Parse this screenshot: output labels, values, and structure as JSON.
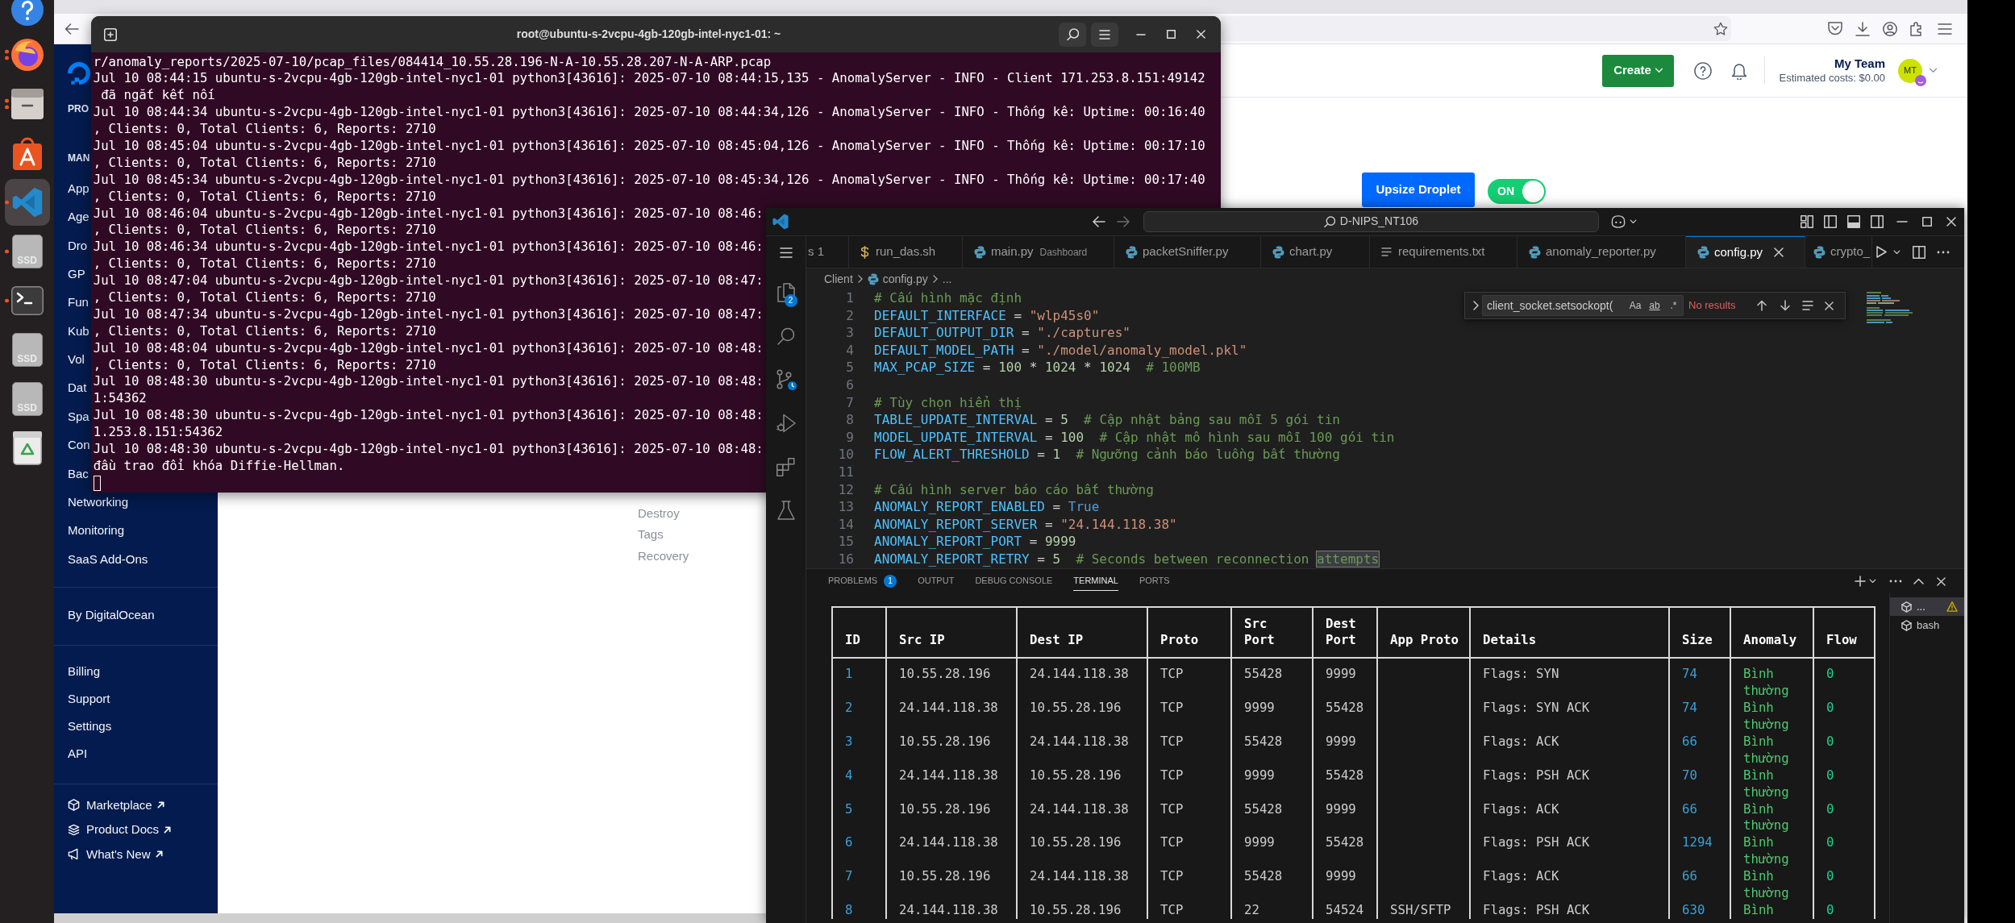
{
  "dock": [
    {
      "kind": "help",
      "running": false,
      "multiple": false,
      "selected": false
    },
    {
      "kind": "browser",
      "running": true,
      "multiple": true,
      "selected": false
    },
    {
      "kind": "files",
      "running": true,
      "multiple": true,
      "selected": false
    },
    {
      "kind": "store",
      "running": false,
      "multiple": false,
      "selected": false
    },
    {
      "kind": "editor",
      "running": true,
      "multiple": false,
      "selected": true
    },
    {
      "kind": "drive",
      "label": "SSD",
      "running": true,
      "multiple": false,
      "selected": false
    },
    {
      "kind": "terminal",
      "running": true,
      "multiple": false,
      "selected": false
    },
    {
      "kind": "drive",
      "label": "SSD",
      "running": false,
      "multiple": false,
      "selected": false
    },
    {
      "kind": "drive",
      "label": "SSD",
      "running": false,
      "multiple": false,
      "selected": false
    },
    {
      "kind": "trash",
      "running": false,
      "multiple": false,
      "selected": false
    }
  ],
  "digitalocean": {
    "sidebar": [
      {
        "items": [
          {
            "kind": "heading",
            "label": "PRO"
          },
          {
            "kind": "heading",
            "label": "MAN"
          },
          {
            "kind": "link",
            "label": "App"
          },
          {
            "kind": "link",
            "label": "Age"
          },
          {
            "kind": "link",
            "label": "Dro"
          },
          {
            "kind": "link",
            "label": "GP"
          },
          {
            "kind": "link",
            "label": "Fun"
          },
          {
            "kind": "link",
            "label": "Kub"
          },
          {
            "kind": "link",
            "label": "Vol"
          },
          {
            "kind": "link",
            "label": "Dat"
          },
          {
            "kind": "link",
            "label": "Spa"
          },
          {
            "kind": "link",
            "label": "Con"
          },
          {
            "kind": "link",
            "label": "Bac"
          },
          {
            "kind": "link",
            "label": "Networking"
          },
          {
            "kind": "link",
            "label": "Monitoring"
          },
          {
            "kind": "link",
            "label": "SaaS Add-Ons"
          }
        ]
      },
      {
        "items": [
          {
            "kind": "link",
            "label": "By DigitalOcean"
          }
        ]
      },
      {
        "items": [
          {
            "kind": "link",
            "label": "Billing"
          },
          {
            "kind": "link",
            "label": "Support"
          },
          {
            "kind": "link",
            "label": "Settings"
          },
          {
            "kind": "link",
            "label": "API"
          }
        ]
      },
      {
        "items": [
          {
            "kind": "external",
            "label": "Marketplace"
          },
          {
            "kind": "external",
            "label": "Product Docs"
          },
          {
            "kind": "external",
            "label": "What's New"
          }
        ]
      }
    ],
    "header": {
      "create": "Create",
      "team": "My Team",
      "costs": "Estimated costs: $0.00",
      "avatar": "MT"
    },
    "droplet": {
      "upsize": "Upsize Droplet",
      "power": {
        "label": "ON",
        "on": true
      },
      "menu": [
        "Destroy",
        "Tags",
        "Recovery"
      ]
    }
  },
  "terminal": {
    "title": "root@ubuntu-s-2vcpu-4gb-120gb-intel-nyc1-01: ~",
    "lines": [
      "r/anomaly_reports/2025-07-10/pcap_files/084414_10.55.28.196-N-A-10.55.28.207-N-A-ARP.pcap",
      "Jul 10 08:44:15 ubuntu-s-2vcpu-4gb-120gb-intel-nyc1-01 python3[43616]: 2025-07-10 08:44:15,135 - AnomalyServer - INFO - Client 171.253.8.151:49142",
      " đã ngắt kết nối",
      "Jul 10 08:44:34 ubuntu-s-2vcpu-4gb-120gb-intel-nyc1-01 python3[43616]: 2025-07-10 08:44:34,126 - AnomalyServer - INFO - Thống kê: Uptime: 00:16:40",
      ", Clients: 0, Total Clients: 6, Reports: 2710",
      "Jul 10 08:45:04 ubuntu-s-2vcpu-4gb-120gb-intel-nyc1-01 python3[43616]: 2025-07-10 08:45:04,126 - AnomalyServer - INFO - Thống kê: Uptime: 00:17:10",
      ", Clients: 0, Total Clients: 6, Reports: 2710",
      "Jul 10 08:45:34 ubuntu-s-2vcpu-4gb-120gb-intel-nyc1-01 python3[43616]: 2025-07-10 08:45:34,126 - AnomalyServer - INFO - Thống kê: Uptime: 00:17:40",
      ", Clients: 0, Total Clients: 6, Reports: 2710",
      "Jul 10 08:46:04 ubuntu-s-2vcpu-4gb-120gb-intel-nyc1-01 python3[43616]: 2025-07-10 08:46:",
      ", Clients: 0, Total Clients: 6, Reports: 2710",
      "Jul 10 08:46:34 ubuntu-s-2vcpu-4gb-120gb-intel-nyc1-01 python3[43616]: 2025-07-10 08:46:",
      ", Clients: 0, Total Clients: 6, Reports: 2710",
      "Jul 10 08:47:04 ubuntu-s-2vcpu-4gb-120gb-intel-nyc1-01 python3[43616]: 2025-07-10 08:47:",
      ", Clients: 0, Total Clients: 6, Reports: 2710",
      "Jul 10 08:47:34 ubuntu-s-2vcpu-4gb-120gb-intel-nyc1-01 python3[43616]: 2025-07-10 08:47:",
      ", Clients: 0, Total Clients: 6, Reports: 2710",
      "Jul 10 08:48:04 ubuntu-s-2vcpu-4gb-120gb-intel-nyc1-01 python3[43616]: 2025-07-10 08:48:",
      ", Clients: 0, Total Clients: 6, Reports: 2710",
      "Jul 10 08:48:30 ubuntu-s-2vcpu-4gb-120gb-intel-nyc1-01 python3[43616]: 2025-07-10 08:48:",
      "1:54362",
      "Jul 10 08:48:30 ubuntu-s-2vcpu-4gb-120gb-intel-nyc1-01 python3[43616]: 2025-07-10 08:48:",
      "1.253.8.151:54362",
      "Jul 10 08:48:30 ubuntu-s-2vcpu-4gb-120gb-intel-nyc1-01 python3[43616]: 2025-07-10 08:48:",
      "đầu trao đổi khóa Diffie-Hellman."
    ]
  },
  "vscode": {
    "command_center": "D-NIPS_NT106",
    "activity": [
      {
        "kind": "explorer",
        "badge": "2"
      },
      {
        "kind": "search"
      },
      {
        "kind": "source_control"
      },
      {
        "kind": "run"
      },
      {
        "kind": "extensions"
      },
      {
        "kind": "testing"
      }
    ],
    "tabs": [
      {
        "label": "s 1",
        "kind": "partial",
        "selected": false
      },
      {
        "label": "run_das.sh",
        "kind": "shell",
        "selected": false
      },
      {
        "label": "main.py",
        "description": "Dashboard",
        "kind": "python",
        "selected": false
      },
      {
        "label": "packetSniffer.py",
        "kind": "python",
        "selected": false
      },
      {
        "label": "chart.py",
        "kind": "python",
        "selected": false
      },
      {
        "label": "requirements.txt",
        "kind": "text",
        "selected": false
      },
      {
        "label": "anomaly_reporter.py",
        "kind": "python",
        "selected": false
      },
      {
        "label": "config.py",
        "kind": "python",
        "selected": true
      },
      {
        "label": "crypto_",
        "kind": "python",
        "selected": false
      }
    ],
    "breadcrumb": [
      "Client",
      "config.py",
      "..."
    ],
    "code": [
      {
        "number": "1",
        "tokens": [
          {
            "kind": "comment",
            "text": "# Cấu hình mặc định"
          }
        ]
      },
      {
        "number": "2",
        "tokens": [
          {
            "kind": "name",
            "text": "DEFAULT_INTERFACE"
          },
          {
            "kind": "op",
            "text": " = "
          },
          {
            "kind": "string",
            "text": "\"wlp45s0\""
          }
        ]
      },
      {
        "number": "3",
        "tokens": [
          {
            "kind": "name",
            "text": "DEFAULT_OUTPUT_DIR"
          },
          {
            "kind": "op",
            "text": " = "
          },
          {
            "kind": "string",
            "text": "\"./captures\""
          }
        ]
      },
      {
        "number": "4",
        "tokens": [
          {
            "kind": "name",
            "text": "DEFAULT_MODEL_PATH"
          },
          {
            "kind": "op",
            "text": " = "
          },
          {
            "kind": "string",
            "text": "\"./model/anomaly_model.pkl\""
          }
        ]
      },
      {
        "number": "5",
        "tokens": [
          {
            "kind": "name",
            "text": "MAX_PCAP_SIZE"
          },
          {
            "kind": "op",
            "text": " = "
          },
          {
            "kind": "number",
            "text": "100"
          },
          {
            "kind": "op",
            "text": " * "
          },
          {
            "kind": "number",
            "text": "1024"
          },
          {
            "kind": "op",
            "text": " * "
          },
          {
            "kind": "number",
            "text": "1024"
          },
          {
            "kind": "comment",
            "text": "  # 100MB"
          }
        ]
      },
      {
        "number": "6"
      },
      {
        "number": "7",
        "tokens": [
          {
            "kind": "comment",
            "text": "# Tùy chọn hiển thị"
          }
        ]
      },
      {
        "number": "8",
        "tokens": [
          {
            "kind": "name",
            "text": "TABLE_UPDATE_INTERVAL"
          },
          {
            "kind": "op",
            "text": " = "
          },
          {
            "kind": "number",
            "text": "5"
          },
          {
            "kind": "comment",
            "text": "  # Cập nhật bảng sau mỗi 5 gói tin"
          }
        ]
      },
      {
        "number": "9",
        "tokens": [
          {
            "kind": "name",
            "text": "MODEL_UPDATE_INTERVAL"
          },
          {
            "kind": "op",
            "text": " = "
          },
          {
            "kind": "number",
            "text": "100"
          },
          {
            "kind": "comment",
            "text": "  # Cập nhật mô hình sau mỗi 100 gói tin"
          }
        ]
      },
      {
        "number": "10",
        "tokens": [
          {
            "kind": "name",
            "text": "FLOW_ALERT_THRESHOLD"
          },
          {
            "kind": "op",
            "text": " = "
          },
          {
            "kind": "number",
            "text": "1"
          },
          {
            "kind": "comment",
            "text": "  # Ngưỡng cảnh báo luồng bất thường"
          }
        ]
      },
      {
        "number": "11"
      },
      {
        "number": "12",
        "tokens": [
          {
            "kind": "comment",
            "text": "# Cấu hình server báo cáo bất thường"
          }
        ]
      },
      {
        "number": "13",
        "tokens": [
          {
            "kind": "name",
            "text": "ANOMALY_REPORT_ENABLED"
          },
          {
            "kind": "op",
            "text": " = "
          },
          {
            "kind": "keyword",
            "text": "True"
          }
        ]
      },
      {
        "number": "14",
        "tokens": [
          {
            "kind": "name",
            "text": "ANOMALY_REPORT_SERVER"
          },
          {
            "kind": "op",
            "text": " = "
          },
          {
            "kind": "string",
            "text": "\"24.144.118.38\""
          }
        ]
      },
      {
        "number": "15",
        "tokens": [
          {
            "kind": "name",
            "text": "ANOMALY_REPORT_PORT"
          },
          {
            "kind": "op",
            "text": " = "
          },
          {
            "kind": "number",
            "text": "9999"
          }
        ]
      },
      {
        "number": "16",
        "tokens": [
          {
            "kind": "name",
            "text": "ANOMALY_REPORT_RETRY"
          },
          {
            "kind": "op",
            "text": " = "
          },
          {
            "kind": "number",
            "text": "5"
          },
          {
            "kind": "comment",
            "text": "  # Seconds between reconnection "
          },
          {
            "kind": "match",
            "text": "attempts"
          }
        ]
      }
    ],
    "find": {
      "query": "client_socket.setsockopt(",
      "options": [
        "Aa",
        "ab",
        ".*"
      ],
      "result": "No results"
    },
    "panel": {
      "tabs": [
        {
          "label": "PROBLEMS",
          "badge": "1",
          "selected": false
        },
        {
          "label": "OUTPUT",
          "selected": false
        },
        {
          "label": "DEBUG CONSOLE",
          "selected": false
        },
        {
          "label": "TERMINAL",
          "selected": true
        },
        {
          "label": "PORTS",
          "selected": false
        }
      ],
      "table": {
        "columns": [
          "ID",
          "Src IP",
          "Dest IP",
          "Proto",
          "Src Port",
          "Dest Port",
          "App Proto",
          "Details",
          "Size",
          "Anomaly",
          "Flow"
        ],
        "rows": [
          {
            "id": "1",
            "src_ip": "10.55.28.196",
            "dest_ip": "24.144.118.38",
            "proto": "TCP",
            "src_port": "55428",
            "dest_port": "9999",
            "details": "Flags: SYN",
            "size": "74",
            "anomaly": "Bình thường",
            "flow": "0"
          },
          {
            "id": "2",
            "src_ip": "24.144.118.38",
            "dest_ip": "10.55.28.196",
            "proto": "TCP",
            "src_port": "9999",
            "dest_port": "55428",
            "details": "Flags: SYN ACK",
            "size": "74",
            "anomaly": "Bình thường",
            "flow": "0"
          },
          {
            "id": "3",
            "src_ip": "10.55.28.196",
            "dest_ip": "24.144.118.38",
            "proto": "TCP",
            "src_port": "55428",
            "dest_port": "9999",
            "details": "Flags: ACK",
            "size": "66",
            "anomaly": "Bình thường",
            "flow": "0"
          },
          {
            "id": "4",
            "src_ip": "24.144.118.38",
            "dest_ip": "10.55.28.196",
            "proto": "TCP",
            "src_port": "9999",
            "dest_port": "55428",
            "details": "Flags: PSH ACK",
            "size": "70",
            "anomaly": "Bình thường",
            "flow": "0"
          },
          {
            "id": "5",
            "src_ip": "10.55.28.196",
            "dest_ip": "24.144.118.38",
            "proto": "TCP",
            "src_port": "55428",
            "dest_port": "9999",
            "details": "Flags: ACK",
            "size": "66",
            "anomaly": "Bình thường",
            "flow": "0"
          },
          {
            "id": "6",
            "src_ip": "24.144.118.38",
            "dest_ip": "10.55.28.196",
            "proto": "TCP",
            "src_port": "9999",
            "dest_port": "55428",
            "details": "Flags: PSH ACK",
            "size": "1294",
            "anomaly": "Bình thường",
            "flow": "0"
          },
          {
            "id": "7",
            "src_ip": "10.55.28.196",
            "dest_ip": "24.144.118.38",
            "proto": "TCP",
            "src_port": "55428",
            "dest_port": "9999",
            "details": "Flags: ACK",
            "size": "66",
            "anomaly": "Bình thường",
            "flow": "0"
          },
          {
            "id": "8",
            "src_ip": "24.144.118.38",
            "dest_ip": "10.55.28.196",
            "proto": "TCP",
            "src_port": "22",
            "dest_port": "54524",
            "app_proto": "SSH/SFTP",
            "details": "Flags: PSH ACK",
            "size": "630",
            "anomaly": "Bình",
            "flow": "0"
          }
        ]
      },
      "terminals": [
        {
          "label": "...",
          "selected": true,
          "warning": true
        },
        {
          "label": "bash",
          "selected": false,
          "warning": false
        }
      ]
    }
  }
}
